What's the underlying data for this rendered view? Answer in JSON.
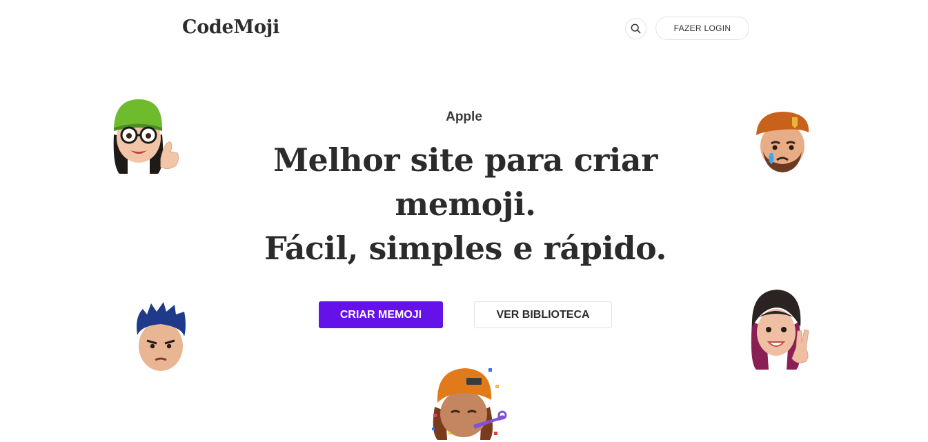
{
  "header": {
    "logo": "CodeMoji",
    "search_icon": "search-icon",
    "login_label": "FAZER LOGIN"
  },
  "hero": {
    "eyebrow": "Apple",
    "headline_lines": [
      "Melhor site para criar",
      "memoji.",
      "Fácil, simples e rápido."
    ],
    "primary_cta": "CRIAR MEMOJI",
    "secondary_cta": "VER BIBLIOTECA"
  },
  "memojis": [
    "memoji-girl-green-beanie-thumbs-up",
    "memoji-man-orange-beret-crying",
    "memoji-boy-blue-hair-frowning",
    "memoji-girl-pink-hair-peace-sign",
    "memoji-party-orange-cap"
  ],
  "colors": {
    "accent": "#6411ea",
    "text": "#2b2b2b",
    "border": "#e2e2e2",
    "background": "#ffffff"
  }
}
